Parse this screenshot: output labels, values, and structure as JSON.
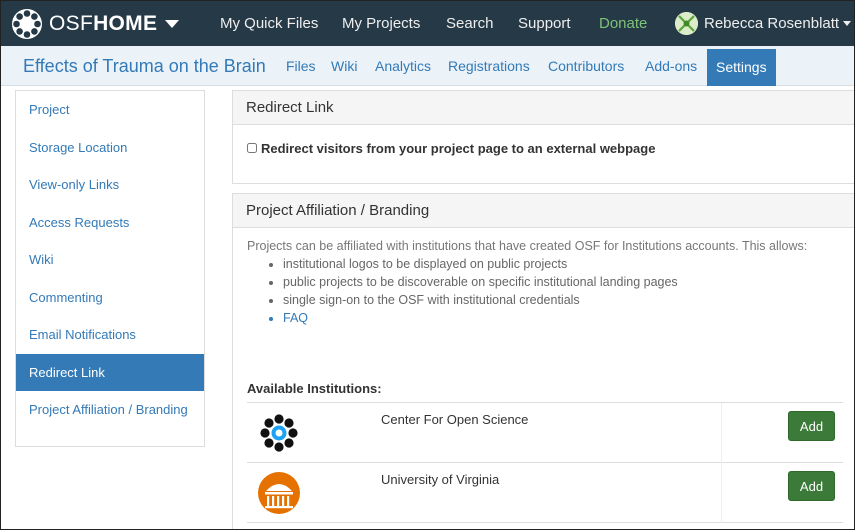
{
  "topbar": {
    "brand_prefix": "OSF",
    "brand_suffix": "HOME",
    "nav": [
      "My Quick Files",
      "My Projects",
      "Search",
      "Support",
      "Donate"
    ],
    "user_name": "Rebecca Rosenblatt"
  },
  "project": {
    "title": "Effects of Trauma on the Brain",
    "tabs": [
      "Files",
      "Wiki",
      "Analytics",
      "Registrations",
      "Contributors",
      "Add-ons",
      "Settings"
    ],
    "active_tab": "Settings"
  },
  "sidebar": {
    "items": [
      "Project",
      "Storage Location",
      "View-only Links",
      "Access Requests",
      "Wiki",
      "Commenting",
      "Email Notifications",
      "Redirect Link",
      "Project Affiliation / Branding"
    ],
    "active": "Redirect Link"
  },
  "redirect": {
    "heading": "Redirect Link",
    "checkbox_label": "Redirect visitors from your project page to an external webpage",
    "checked": false
  },
  "affiliation": {
    "heading": "Project Affiliation / Branding",
    "intro": "Projects can be affiliated with institutions that have created OSF for Institutions accounts. This allows:",
    "bullets": [
      "institutional logos to be displayed on public projects",
      "public projects to be discoverable on specific institutional landing pages",
      "single sign-on to the OSF with institutional credentials"
    ],
    "faq_link": "FAQ",
    "available_label": "Available Institutions:",
    "institutions": [
      {
        "name": "Center For Open Science",
        "action": "Add",
        "logo": "cos-logo"
      },
      {
        "name": "University of Virginia",
        "action": "Add",
        "logo": "uva-logo"
      }
    ]
  },
  "colors": {
    "topbar": "#263947",
    "link": "#337ab7",
    "donate": "#7ec37a",
    "add_button": "#3c7a39",
    "uva_orange": "#e57200"
  }
}
